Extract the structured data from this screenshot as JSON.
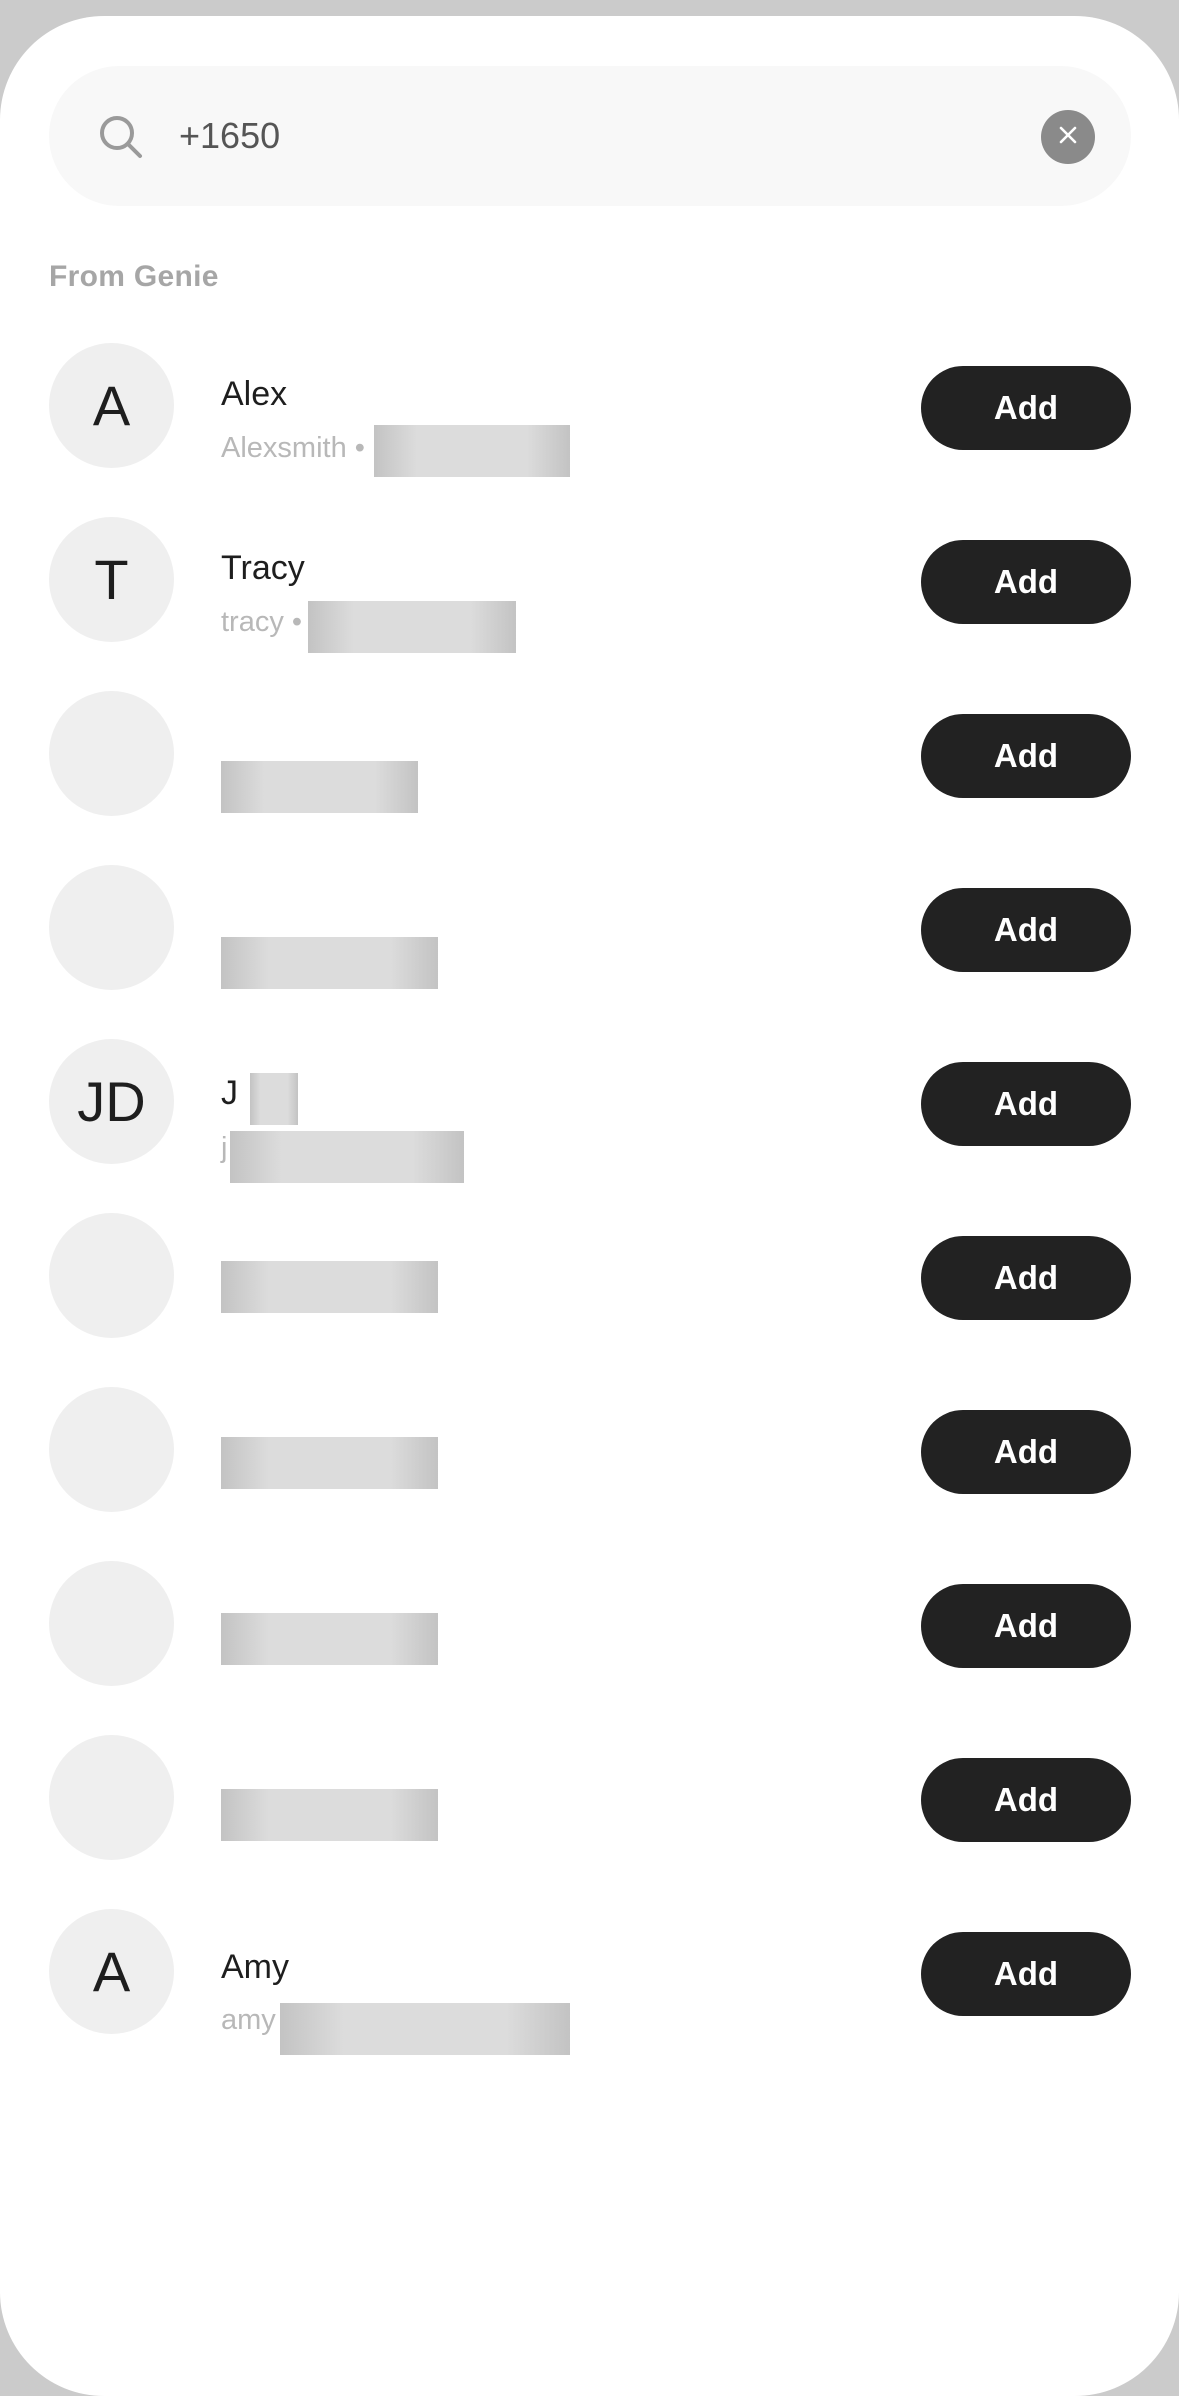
{
  "search": {
    "value": "+1650",
    "icon": "search-icon",
    "clear_icon": "close-icon"
  },
  "section": {
    "label": "From Genie"
  },
  "contacts": [
    {
      "initials": "A",
      "name": "Alex",
      "handle": "Alexsmith •",
      "add_label": "Add"
    },
    {
      "initials": "T",
      "name": "Tracy",
      "handle": "tracy •",
      "add_label": "Add"
    },
    {
      "initials": "",
      "name": "",
      "handle": "",
      "add_label": "Add"
    },
    {
      "initials": "",
      "name": "",
      "handle": "",
      "add_label": "Add"
    },
    {
      "initials": "JD",
      "name": "J",
      "handle": "j",
      "add_label": "Add"
    },
    {
      "initials": "",
      "name": "",
      "handle": "",
      "add_label": "Add"
    },
    {
      "initials": "",
      "name": "",
      "handle": "",
      "add_label": "Add"
    },
    {
      "initials": "",
      "name": "",
      "handle": "",
      "add_label": "Add"
    },
    {
      "initials": "",
      "name": "",
      "handle": "",
      "add_label": "Add"
    },
    {
      "initials": "A",
      "name": "Amy",
      "handle": "amy",
      "add_label": "Add"
    }
  ],
  "colors": {
    "button_bg": "#222222",
    "avatar_bg": "#efefef",
    "muted_text": "#a6a6a6"
  }
}
